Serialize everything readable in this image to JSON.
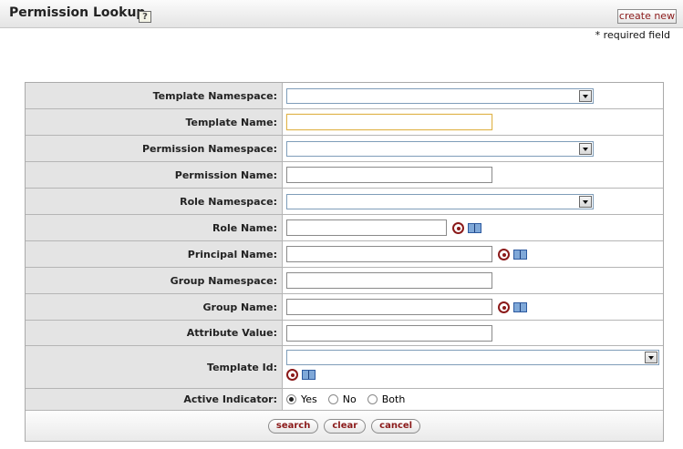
{
  "header": {
    "title": "Permission Lookup",
    "help_icon": "?",
    "create_new_label": "create new"
  },
  "required_note": "* required field",
  "form": {
    "template_namespace": {
      "label": "Template Namespace:",
      "value": ""
    },
    "template_name": {
      "label": "Template Name:",
      "value": ""
    },
    "permission_namespace": {
      "label": "Permission Namespace:",
      "value": ""
    },
    "permission_name": {
      "label": "Permission Name:",
      "value": ""
    },
    "role_namespace": {
      "label": "Role Namespace:",
      "value": ""
    },
    "role_name": {
      "label": "Role Name:",
      "value": ""
    },
    "principal_name": {
      "label": "Principal Name:",
      "value": ""
    },
    "group_namespace": {
      "label": "Group Namespace:",
      "value": ""
    },
    "group_name": {
      "label": "Group Name:",
      "value": ""
    },
    "attribute_value": {
      "label": "Attribute Value:",
      "value": ""
    },
    "template_id": {
      "label": "Template Id:",
      "value": ""
    },
    "active_indicator": {
      "label": "Active Indicator:",
      "options": [
        "Yes",
        "No",
        "Both"
      ],
      "selected": "Yes"
    }
  },
  "buttons": {
    "search": "search",
    "clear": "clear",
    "cancel": "cancel"
  },
  "colors": {
    "label_bg": "#e4e4e4",
    "button_text": "#8b1a1a",
    "focus_border": "#e0b44c"
  }
}
